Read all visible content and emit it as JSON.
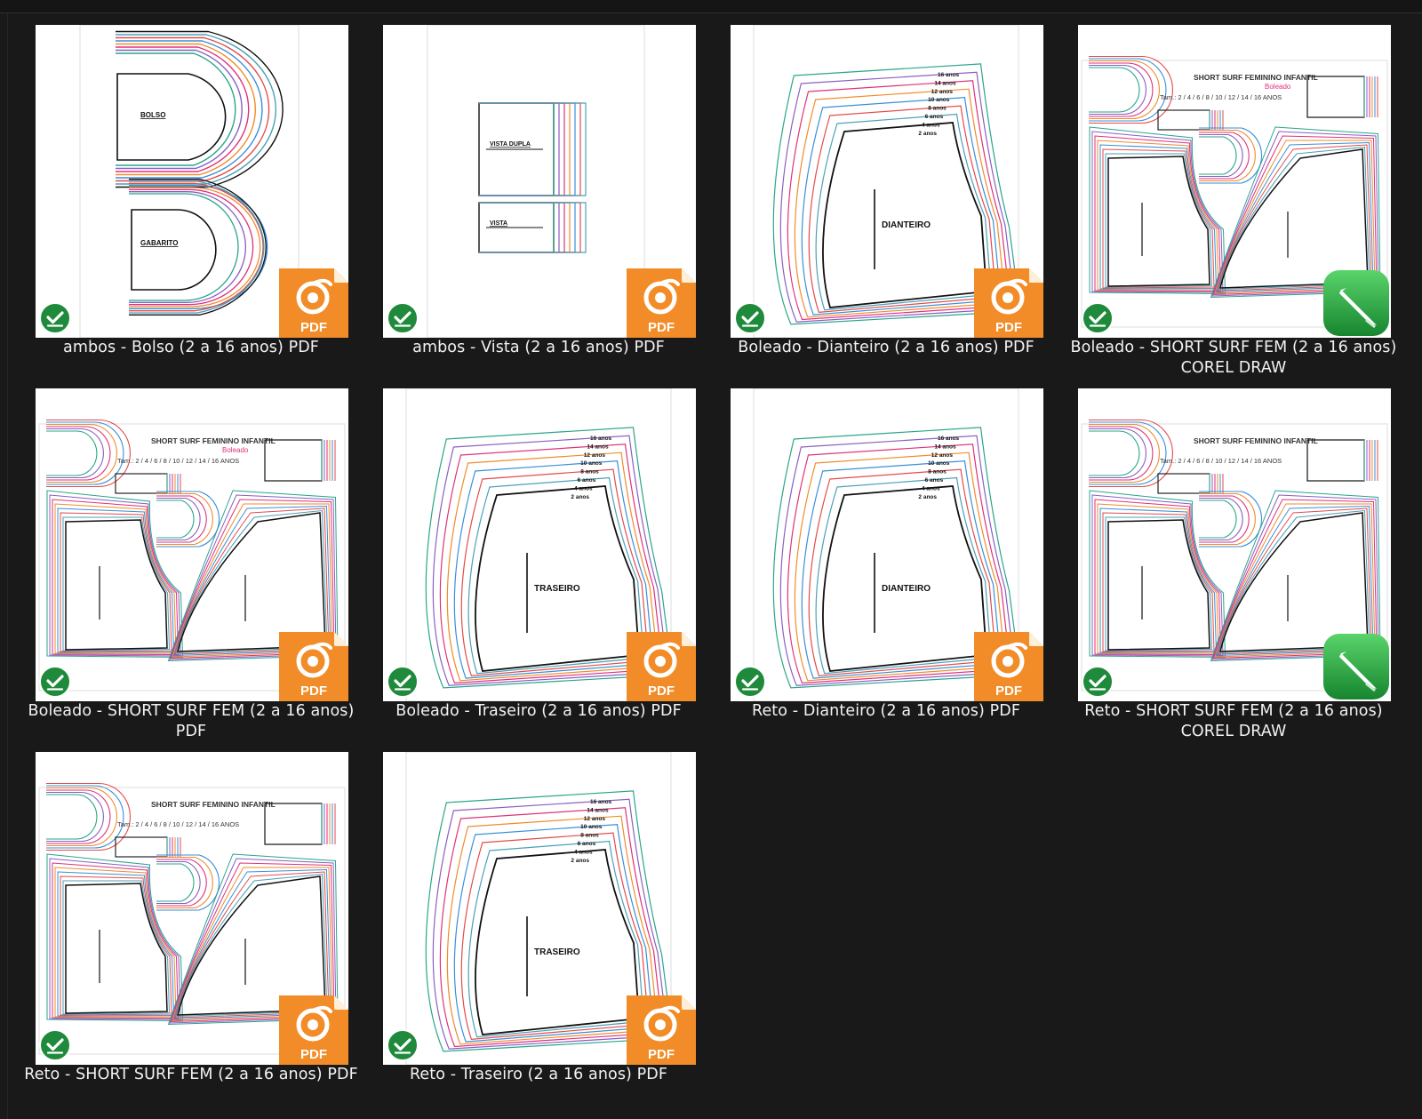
{
  "items": [
    {
      "label": "ambos - Bolso (2 a 16 anos) PDF",
      "app": "pdf",
      "art": "bolso",
      "synced": true,
      "heading_1": "BOLSO",
      "heading_2": "GABARITO"
    },
    {
      "label": "ambos - Vista (2 a 16 anos) PDF",
      "app": "pdf",
      "art": "vista",
      "synced": true,
      "heading_1": "VISTA DUPLA",
      "heading_2": "VISTA"
    },
    {
      "label": "Boleado - Dianteiro (2 a 16 anos) PDF",
      "app": "pdf",
      "art": "piece",
      "synced": true,
      "heading_1": "DIANTEIRO"
    },
    {
      "label": "Boleado - SHORT SURF FEM (2 a 16 anos) COREL DRAW",
      "app": "corel",
      "art": "sheet",
      "synced": true,
      "heading_1": "SHORT SURF FEMININO INFANTIL",
      "heading_2": "Tam.: 2 / 4 / 6 / 8 / 10 / 12 / 14 / 16 ANOS",
      "badge": "Boleado"
    },
    {
      "label": "Boleado - SHORT SURF FEM (2 a 16 anos) PDF",
      "app": "pdf",
      "art": "sheet",
      "synced": true,
      "heading_1": "SHORT SURF FEMININO INFANTIL",
      "heading_2": "Tam.: 2 / 4 / 6 / 8 / 10 / 12 / 14 / 16 ANOS",
      "badge": "Boleado"
    },
    {
      "label": "Boleado - Traseiro  (2 a 16 anos) PDF",
      "app": "pdf",
      "art": "piece",
      "synced": true,
      "heading_1": "TRASEIRO"
    },
    {
      "label": "Reto - Dianteiro (2 a 16 anos) PDF",
      "app": "pdf",
      "art": "piece",
      "synced": true,
      "heading_1": "DIANTEIRO"
    },
    {
      "label": "Reto - SHORT SURF FEM (2 a 16 anos) COREL DRAW",
      "app": "corel",
      "art": "sheet",
      "synced": true,
      "heading_1": "SHORT SURF FEMININO INFANTIL",
      "heading_2": "Tam.: 2 / 4 / 6 / 8 / 10 / 12 / 14 / 16 ANOS"
    },
    {
      "label": "Reto - SHORT SURF FEM (2 a 16 anos) PDF",
      "app": "pdf",
      "art": "sheet",
      "synced": true,
      "heading_1": "SHORT SURF FEMININO INFANTIL",
      "heading_2": "Tam.: 2 / 4 / 6 / 8 / 10 / 12 / 14 / 16 ANOS"
    },
    {
      "label": "Reto - Traseiro (2 a 16 anos) PDF",
      "app": "pdf",
      "art": "piece",
      "synced": true,
      "heading_1": "TRASEIRO"
    }
  ],
  "size_labels": [
    "16 anos",
    "14 anos",
    "12 anos",
    "10 anos",
    "8 anos",
    "6 anos",
    "4 anos",
    "2 anos"
  ],
  "app_badges": {
    "pdf": "PDF"
  },
  "icons": {
    "sync": "check-circle-icon",
    "pdf": "foxit-pdf-icon",
    "corel": "coreldraw-pen-icon"
  },
  "colors": {
    "background": "#191919",
    "text": "#f2f2f2",
    "sync_green": "#1f8a3b",
    "pdf_orange": "#f28c28",
    "corel_green": "#2fb24c",
    "size_colors": [
      "#2aa58a",
      "#8a5fc4",
      "#e0327a",
      "#f08c2a",
      "#3a8fd8",
      "#e44b4b",
      "#4aa0b8",
      "#111111"
    ]
  }
}
